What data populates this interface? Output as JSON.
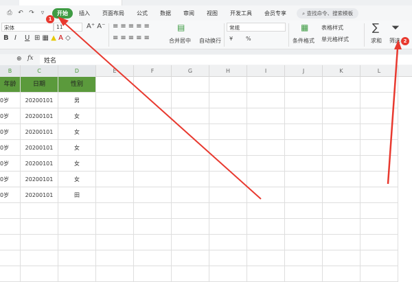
{
  "menu": {
    "quick": [
      "⎙",
      "↶",
      "↷",
      "▿"
    ],
    "tabs": [
      "开始",
      "插入",
      "页面布局",
      "公式",
      "数据",
      "审阅",
      "视图",
      "开发工具",
      "会员专享"
    ],
    "search": "查找命令、搜索模板"
  },
  "ribbon": {
    "font": "宋体",
    "size": "11",
    "format": "常规",
    "merge": "合并居中",
    "wrap": "自动换行",
    "cond": "条件格式",
    "table_style": "表格样式",
    "cell_style": "单元格样式",
    "sum": "求和",
    "filter": "筛选",
    "currency": "¥",
    "percent": "%"
  },
  "formula": {
    "fx": "fx",
    "value": "姓名"
  },
  "columns": [
    "B",
    "C",
    "D",
    "E",
    "F",
    "G",
    "H",
    "I",
    "J",
    "K",
    "L"
  ],
  "table": {
    "headers": [
      "年龄",
      "日期",
      "性别"
    ],
    "rows": [
      [
        "0岁",
        "20200101",
        "男"
      ],
      [
        "0岁",
        "20200101",
        "女"
      ],
      [
        "0岁",
        "20200101",
        "女"
      ],
      [
        "0岁",
        "20200101",
        "女"
      ],
      [
        "0岁",
        "20200101",
        "女"
      ],
      [
        "0岁",
        "20200101",
        "女"
      ],
      [
        "0岁",
        "20200101",
        "田"
      ]
    ]
  },
  "badges": [
    "1",
    "2"
  ],
  "colors": {
    "accent": "#3e9b43",
    "header_fill": "#5b9a3c",
    "arrow": "#e8392f"
  }
}
